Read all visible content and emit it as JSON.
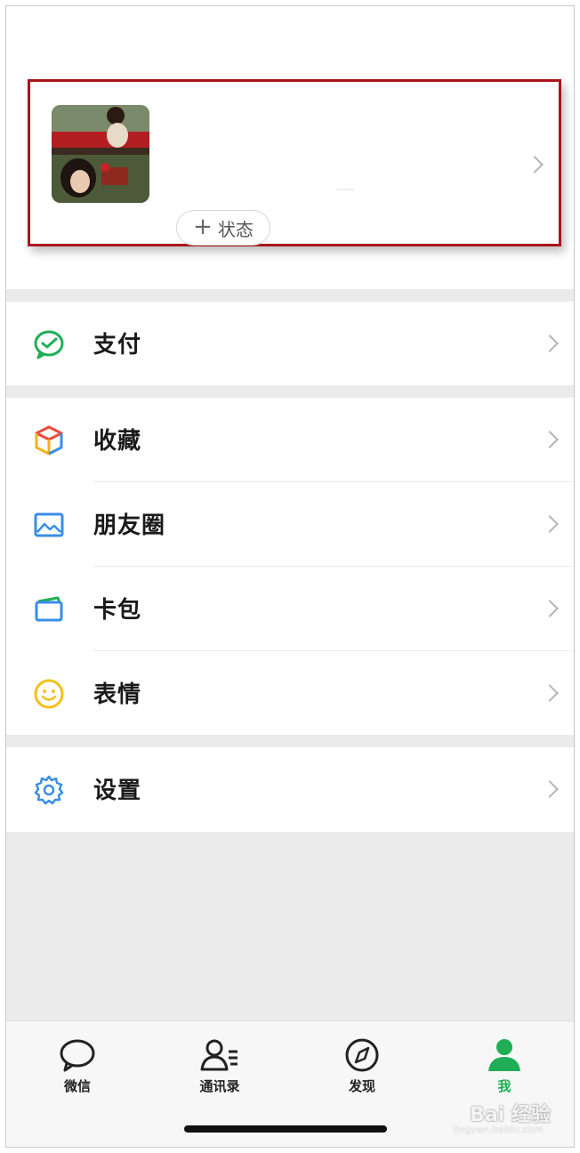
{
  "profile": {
    "status_button": {
      "plus": "+",
      "label": "状态"
    }
  },
  "menu": {
    "pay": {
      "label": "支付",
      "icon": "pay-icon"
    },
    "favorites": {
      "label": "收藏",
      "icon": "favorites-cube-icon"
    },
    "moments": {
      "label": "朋友圈",
      "icon": "moments-photo-icon"
    },
    "cards": {
      "label": "卡包",
      "icon": "card-wallet-icon"
    },
    "stickers": {
      "label": "表情",
      "icon": "smiley-icon"
    },
    "settings": {
      "label": "设置",
      "icon": "gear-icon"
    }
  },
  "tabbar": {
    "tabs": [
      {
        "label": "微信",
        "icon": "chat-bubble-icon",
        "active": false
      },
      {
        "label": "通讯录",
        "icon": "contacts-icon",
        "active": false
      },
      {
        "label": "发现",
        "icon": "compass-icon",
        "active": false
      },
      {
        "label": "我",
        "icon": "person-icon",
        "active": true
      }
    ]
  },
  "watermark": {
    "main": "Bai 经验",
    "sub": "jingyan.baidu.com"
  },
  "colors": {
    "accent_green": "#1fae55",
    "highlight_border": "#a8141c",
    "separator_gray": "#ebebeb"
  }
}
